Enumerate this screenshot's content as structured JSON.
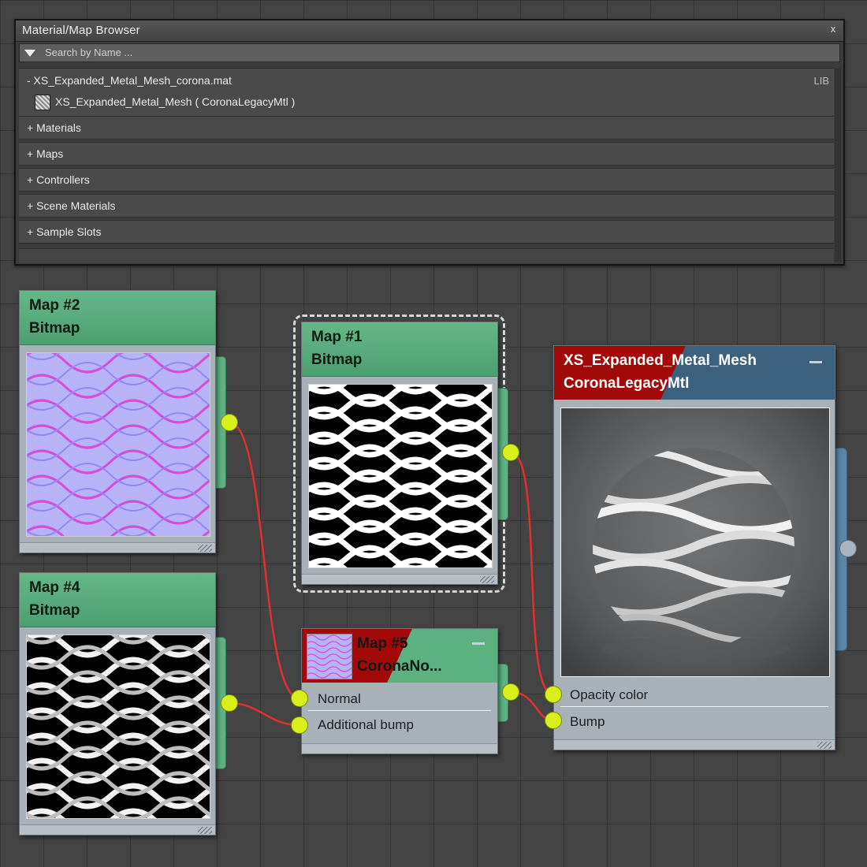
{
  "browser": {
    "title": "Material/Map Browser",
    "close_glyph": "x",
    "search_placeholder": "Search by Name ...",
    "library": {
      "name": "- XS_Expanded_Metal_Mesh_corona.mat",
      "tag": "LIB",
      "item": "XS_Expanded_Metal_Mesh  ( CoronaLegacyMtl )"
    },
    "categories": [
      "+ Materials",
      "+ Maps",
      "+ Controllers",
      "+ Scene Materials",
      "+ Sample Slots"
    ]
  },
  "nodes": {
    "map2": {
      "title1": "Map #2",
      "title2": "Bitmap",
      "thumbnail": "normal-map-mesh"
    },
    "map4": {
      "title1": "Map #4",
      "title2": "Bitmap",
      "thumbnail": "bump-map-mesh"
    },
    "map1": {
      "title1": "Map #1",
      "title2": "Bitmap",
      "thumbnail": "opacity-map-mesh"
    },
    "map5": {
      "title1": "Map #5",
      "title2": "CoronaNo...",
      "slots": [
        "Normal",
        "Additional bump"
      ]
    },
    "material": {
      "title1": "XS_Expanded_Metal_Mesh",
      "title2": "CoronaLegacyMtl",
      "preview": "metal-mesh-sphere",
      "slots": [
        "Opacity color",
        "Bump"
      ]
    }
  },
  "colors": {
    "node_header_green": "#5bb180",
    "material_red": "#a20a0a",
    "material_blue": "#3b617f",
    "socket_yellow": "#d9ef1a",
    "wire_red": "#e03030",
    "node_body": "#a8b0b8"
  }
}
